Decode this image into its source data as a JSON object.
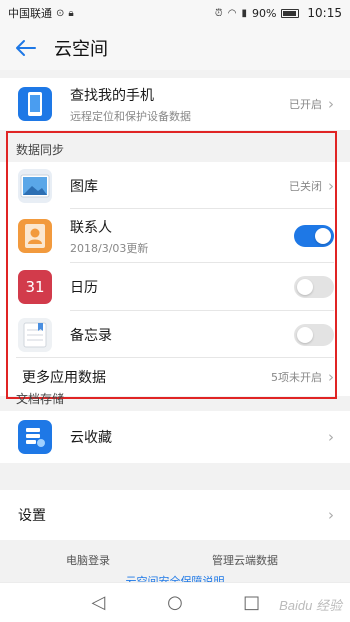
{
  "status_bar": {
    "carrier": "中国联通",
    "battery": "90%",
    "time": "10:15"
  },
  "header": {
    "title": "云空间"
  },
  "find_phone": {
    "title": "查找我的手机",
    "subtitle": "远程定位和保护设备数据",
    "status": "已开启"
  },
  "data_sync": {
    "heading": "数据同步",
    "items": [
      {
        "title": "图库",
        "status": "已关闭"
      },
      {
        "title": "联系人",
        "subtitle": "2018/3/03更新",
        "toggle": "on"
      },
      {
        "title": "日历",
        "icon_text": "31",
        "toggle": "off"
      },
      {
        "title": "备忘录",
        "toggle": "off"
      }
    ],
    "more": {
      "title": "更多应用数据",
      "status": "5项未开启"
    }
  },
  "doc_storage": {
    "heading": "文档存储",
    "item": {
      "title": "云收藏"
    }
  },
  "settings": {
    "title": "设置"
  },
  "footer": {
    "pc_login": "电脑登录",
    "manage_cloud": "管理云端数据",
    "privacy": "云空间安全保障说明"
  },
  "watermark": "Baidu 经验",
  "colors": {
    "accent": "#1e78e6",
    "highlight_frame": "#e02424"
  }
}
